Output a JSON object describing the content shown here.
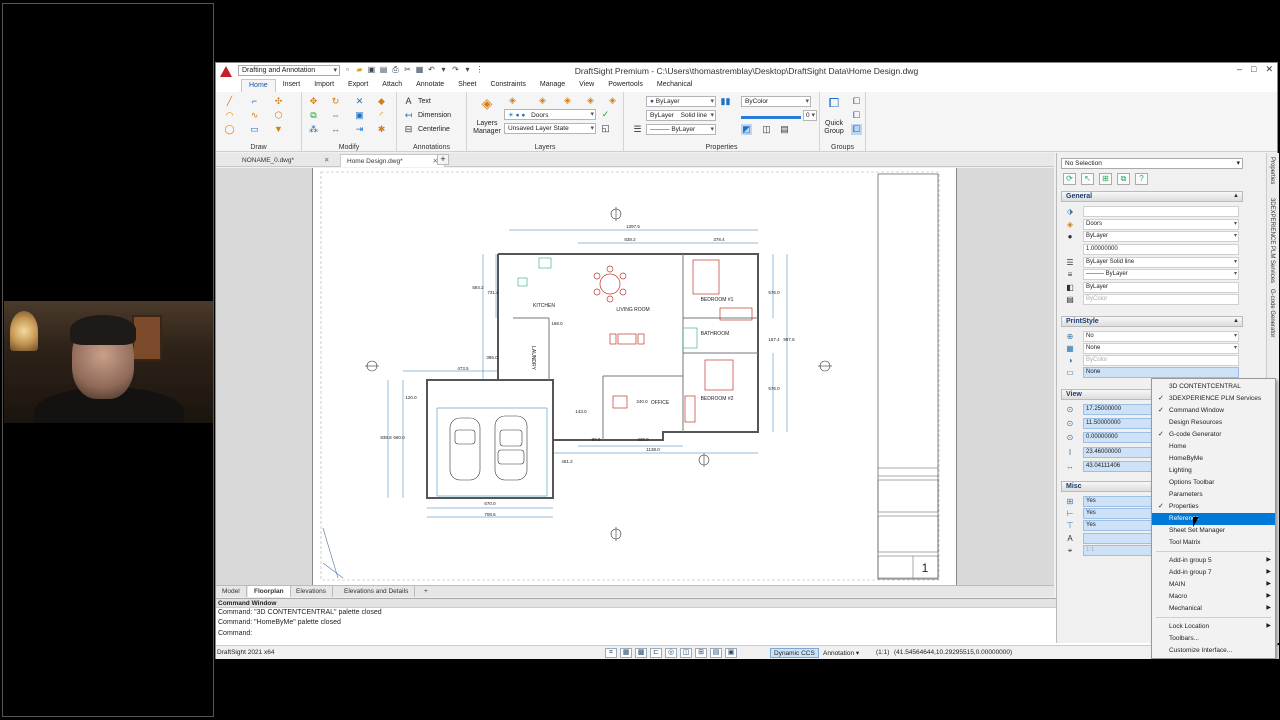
{
  "window": {
    "title": "DraftSight Premium - C:\\Users\\thomastremblay\\Desktop\\DraftSight Data\\Home Design.dwg",
    "workspace": "Drafting and Annotation",
    "controls": [
      "–",
      "□",
      "✕"
    ],
    "doc_controls": [
      "♡",
      "–",
      "□",
      "✕"
    ]
  },
  "ribbon": {
    "tabs": [
      "Home",
      "Insert",
      "Import",
      "Export",
      "Attach",
      "Annotate",
      "Sheet",
      "Constraints",
      "Manage",
      "View",
      "Powertools",
      "Mechanical"
    ],
    "active_tab": "Home",
    "groups": {
      "draw": "Draw",
      "modify": "Modify",
      "annotations": "Annotations",
      "layers": "Layers",
      "properties": "Properties",
      "groups": "Groups"
    },
    "annotations": {
      "text": "Text",
      "dimension": "Dimension",
      "centerline": "Centerline"
    },
    "layers": {
      "manager_label_1": "Layers",
      "manager_label_2": "Manager",
      "layer_combo": "Doors",
      "layer_state": "Unsaved Layer State"
    },
    "properties": {
      "color": "ByLayer",
      "linestyle_a": "ByLayer",
      "linestyle_b": "Solid line",
      "lineweight": "ByLayer",
      "print_style": "ByColor",
      "transparency": "0"
    },
    "groups_btn": {
      "label_1": "Quick",
      "label_2": "Group"
    }
  },
  "doc_tabs": [
    {
      "label": "NONAME_0.dwg*",
      "active": false
    },
    {
      "label": "Home Design.dwg*",
      "active": true
    }
  ],
  "sheet_tabs": [
    "Model",
    "Floorplan",
    "Elevations",
    "Elevations and Details"
  ],
  "active_sheet": "Floorplan",
  "drawing": {
    "rooms": [
      "KITCHEN",
      "LIVING ROOM",
      "BEDROOM #1",
      "BATHROOM",
      "BEDROOM #2",
      "OFFICE",
      "LAUNDRY"
    ],
    "dims": [
      "1397.6",
      "838.2",
      "378.4",
      "584.2",
      "731.4",
      "598.6",
      "386.0",
      "473.5",
      "120.0",
      "838.8",
      "660.0",
      "670.0",
      "708.6",
      "90.0",
      "420.0",
      "1138.0",
      "143.0",
      "240.0",
      "576.0",
      "157.4",
      "576.0",
      "997.6",
      "461.2",
      "168.0"
    ],
    "sheet_number": "1"
  },
  "command_window": {
    "title": "Command Window",
    "lines": [
      "Command: \"3D CONTENTCENTRAL\" palette closed",
      "Command: \"HomeByMe\" palette closed",
      "Command:"
    ]
  },
  "status_bar": {
    "version": "DraftSight 2021 x64",
    "dynamic_ccs": "Dynamic CCS",
    "annotation": "Annotation",
    "scale": "(1:1)",
    "coords": "(41.54564644,10.29295515,0.00000000)"
  },
  "properties_palette": {
    "selection": "No Selection",
    "sections": {
      "general": "General",
      "printstyle": "PrintStyle",
      "view": "View",
      "misc": "Misc"
    },
    "general_rows": [
      "",
      "Doors",
      "ByLayer",
      "1.00000000",
      "ByLayer    Solid line",
      "——— ByLayer",
      "ByLayer",
      "ByColor"
    ],
    "printstyle_rows": [
      "No",
      "None",
      "ByColor",
      "None"
    ],
    "view_rows": [
      "17.25000000",
      "11.50000000",
      "0.00000000",
      "23.46000000",
      "43.04111406"
    ],
    "misc_rows": [
      "Yes",
      "Yes",
      "Yes",
      "",
      "1:1"
    ]
  },
  "vertical_tabs": [
    "Properties",
    "3DEXPERIENCE PLM Services",
    "G-code Generator"
  ],
  "context_menu": {
    "items": [
      {
        "label": "3D CONTENTCENTRAL",
        "checked": false
      },
      {
        "label": "3DEXPERIENCE PLM Services",
        "checked": true
      },
      {
        "label": "Command Window",
        "checked": true
      },
      {
        "label": "Design Resources",
        "checked": false
      },
      {
        "label": "G-code Generator",
        "checked": true
      },
      {
        "label": "Home",
        "checked": false
      },
      {
        "label": "HomeByMe",
        "checked": false
      },
      {
        "label": "Lighting",
        "checked": false
      },
      {
        "label": "Options Toolbar",
        "checked": false
      },
      {
        "label": "Parameters",
        "checked": false
      },
      {
        "label": "Properties",
        "checked": true
      },
      {
        "label": "Reference",
        "checked": false,
        "highlighted": true
      },
      {
        "label": "Sheet Set Manager",
        "checked": false
      },
      {
        "label": "Tool Matrix",
        "checked": false
      }
    ],
    "submenus": [
      "Add-in group 5",
      "Add-in group 7",
      "MAIN",
      "Macro",
      "Mechanical"
    ],
    "footer": [
      "Lock Location",
      "Toolbars...",
      "Customize Interface..."
    ]
  },
  "colors": {
    "accent": "#0078d7",
    "wall": "#555555",
    "furniture": "#c0392b",
    "dimension": "#2a7ab8"
  }
}
